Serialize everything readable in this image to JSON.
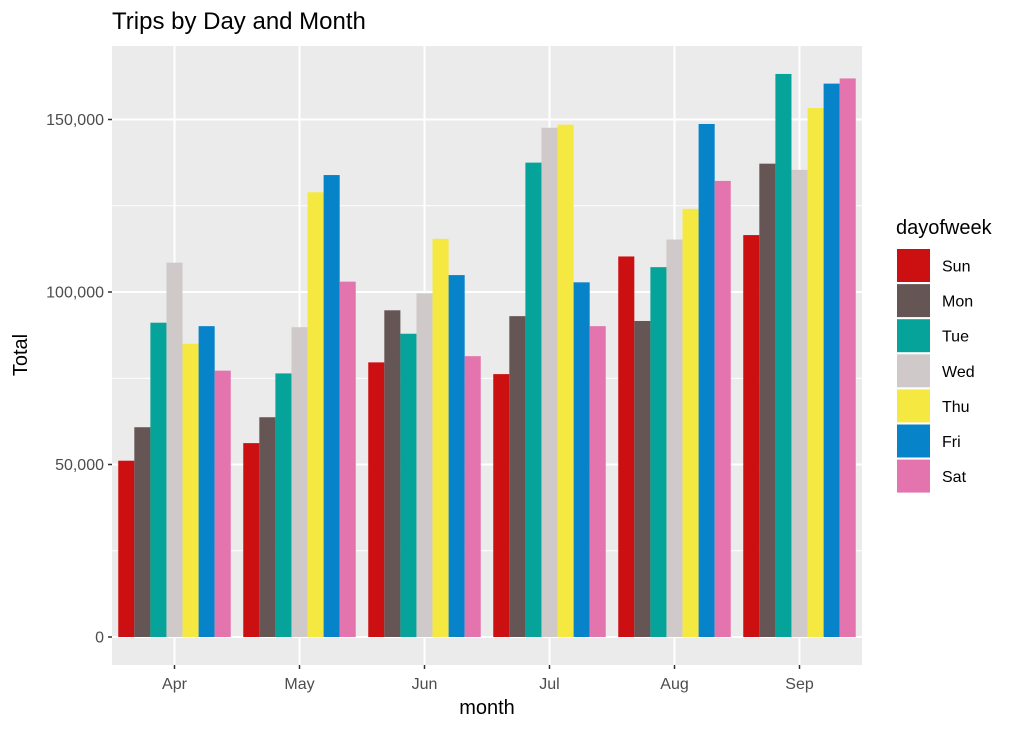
{
  "chart_data": {
    "type": "bar",
    "title": "Trips by Day and Month",
    "xlabel": "month",
    "ylabel": "Total",
    "categories": [
      "Apr",
      "May",
      "Jun",
      "Jul",
      "Aug",
      "Sep"
    ],
    "ylim": [
      0,
      165000
    ],
    "yticks": [
      0,
      50000,
      100000,
      150000
    ],
    "ytick_labels": [
      "0",
      "50,000",
      "100,000",
      "150,000"
    ],
    "grid": true,
    "legend": {
      "title": "dayofweek",
      "position": "right"
    },
    "series": [
      {
        "name": "Sun",
        "color": "#CC1011",
        "values": [
          51100,
          56200,
          79600,
          76200,
          110300,
          116500
        ]
      },
      {
        "name": "Mon",
        "color": "#665555",
        "values": [
          60800,
          63700,
          94700,
          93000,
          91600,
          137200
        ]
      },
      {
        "name": "Tue",
        "color": "#05A399",
        "values": [
          91100,
          76400,
          87900,
          137500,
          107200,
          163200
        ]
      },
      {
        "name": "Wed",
        "color": "#CFCAC9",
        "values": [
          108500,
          89800,
          99600,
          147600,
          115200,
          135400
        ]
      },
      {
        "name": "Thu",
        "color": "#F5E840",
        "values": [
          85000,
          128900,
          115400,
          148500,
          124100,
          153300
        ]
      },
      {
        "name": "Fri",
        "color": "#0683C9",
        "values": [
          90100,
          133900,
          104900,
          102800,
          148700,
          160400
        ]
      },
      {
        "name": "Sat",
        "color": "#E374AE",
        "values": [
          77200,
          103000,
          81400,
          90100,
          132200,
          161900
        ]
      }
    ]
  },
  "colors": {
    "panel_background": "#EBEBEB",
    "grid_major": "#FFFFFF",
    "tick_text": "#4D4D4D"
  }
}
